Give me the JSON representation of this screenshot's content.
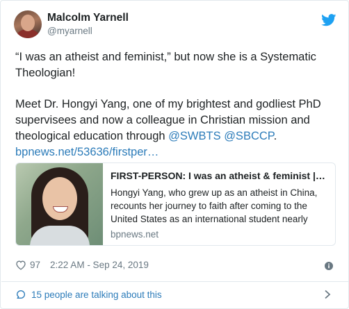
{
  "author": {
    "name": "Malcolm Yarnell",
    "handle": "@myarnell"
  },
  "tweet": {
    "line1": "“I was an atheist and feminist,” but now she is a Systematic Theologian!",
    "para2_text": "Meet Dr. Hongyi Yang, one of my brightest and godliest PhD supervisees and now a colleague in Christian mission and theological education through ",
    "mention1": "@SWBTS",
    "mention2": "@SBCCP",
    "period": ".",
    "url": "bpnews.net/53636/firstper…"
  },
  "preview": {
    "title": "FIRST-PERSON: I was an atheist & feminist |…",
    "description": "Hongyi Yang, who grew up as an atheist in China, recounts her journey to faith after coming to the United States as an international student nearly",
    "domain": "bpnews.net"
  },
  "meta": {
    "likes": "97",
    "timestamp": "2:22 AM - Sep 24, 2019"
  },
  "footer": {
    "talking": "15 people are talking about this"
  },
  "icons": {
    "twitter": "twitter-bird-icon",
    "like": "heart-icon",
    "info": "info-icon",
    "conversation": "speech-bubble-icon",
    "chevron": "chevron-right-icon"
  },
  "colors": {
    "link": "#2b7bb9",
    "muted": "#697882",
    "twitter_blue": "#1da1f2",
    "border": "#e1e8ed"
  }
}
